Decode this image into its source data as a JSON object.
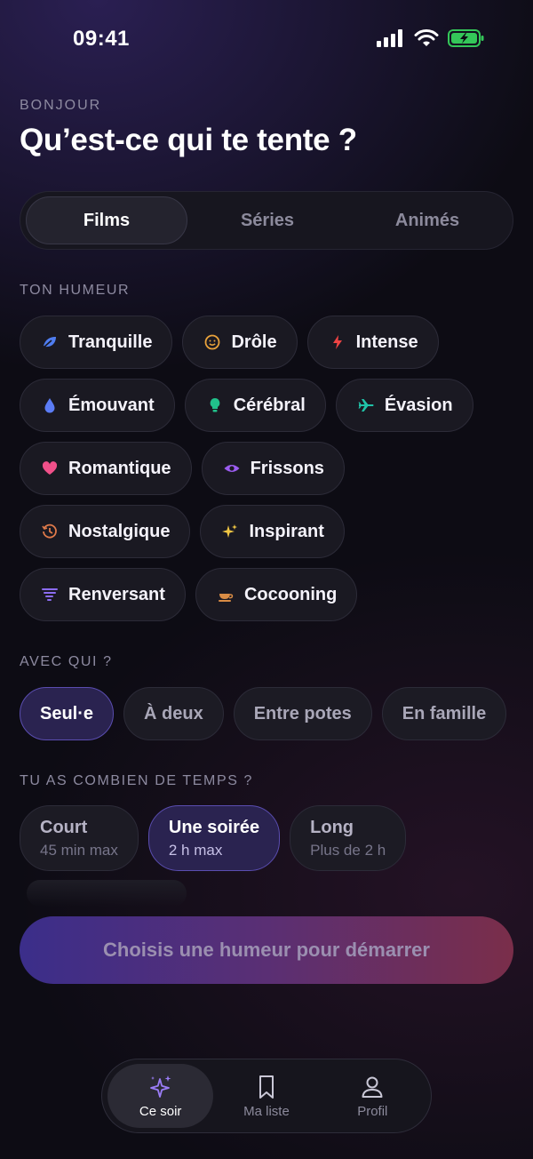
{
  "status": {
    "time": "09:41"
  },
  "header": {
    "greeting": "BONJOUR",
    "title": "Qu’est-ce qui te tente ?"
  },
  "segments": [
    {
      "label": "Films",
      "active": true
    },
    {
      "label": "Séries",
      "active": false
    },
    {
      "label": "Animés",
      "active": false
    }
  ],
  "mood": {
    "title": "TON HUMEUR",
    "items": [
      {
        "label": "Tranquille",
        "icon": "leaf-icon",
        "color": "#4f7df0"
      },
      {
        "label": "Drôle",
        "icon": "smile-icon",
        "color": "#e9a23b"
      },
      {
        "label": "Intense",
        "icon": "bolt-icon",
        "color": "#ef4444"
      },
      {
        "label": "Émouvant",
        "icon": "drop-icon",
        "color": "#5b7cf5"
      },
      {
        "label": "Cérébral",
        "icon": "bulb-icon",
        "color": "#21c08a"
      },
      {
        "label": "Évasion",
        "icon": "plane-icon",
        "color": "#20c2a8"
      },
      {
        "label": "Romantique",
        "icon": "heart-icon",
        "color": "#f0508a"
      },
      {
        "label": "Frissons",
        "icon": "eye-icon",
        "color": "#9b5cf0"
      },
      {
        "label": "Nostalgique",
        "icon": "history-icon",
        "color": "#e07a4a"
      },
      {
        "label": "Inspirant",
        "icon": "sparkle-icon",
        "color": "#f2c744"
      },
      {
        "label": "Renversant",
        "icon": "tornado-icon",
        "color": "#8b6cf2"
      },
      {
        "label": "Cocooning",
        "icon": "cup-icon",
        "color": "#d98c45"
      }
    ]
  },
  "company": {
    "title": "AVEC QUI ?",
    "items": [
      {
        "label": "Seul·e",
        "selected": true
      },
      {
        "label": "À deux",
        "selected": false
      },
      {
        "label": "Entre potes",
        "selected": false
      },
      {
        "label": "En famille",
        "selected": false
      }
    ]
  },
  "duration": {
    "title": "TU AS COMBIEN DE TEMPS ?",
    "items": [
      {
        "label": "Court",
        "sub": "45 min max",
        "selected": false
      },
      {
        "label": "Une soirée",
        "sub": "2 h max",
        "selected": true
      },
      {
        "label": "Long",
        "sub": "Plus de 2 h",
        "selected": false
      }
    ]
  },
  "cta": {
    "label": "Choisis une humeur pour démarrer"
  },
  "tabbar": [
    {
      "label": "Ce soir",
      "icon": "sparkles-icon",
      "active": true
    },
    {
      "label": "Ma liste",
      "icon": "bookmark-icon",
      "active": false
    },
    {
      "label": "Profil",
      "icon": "user-icon",
      "active": false
    }
  ],
  "colors": {
    "accent": "#8b6cf2",
    "background": "#0d0c14",
    "battery": "#34c759"
  }
}
